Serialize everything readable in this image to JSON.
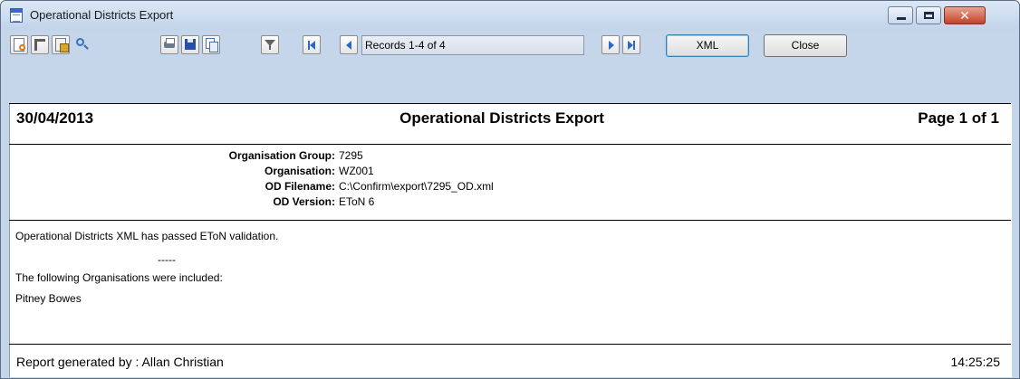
{
  "window": {
    "title": "Operational Districts Export",
    "close_glyph": "✕"
  },
  "toolbar": {
    "records": "Records 1-4 of 4",
    "xml_label": "XML",
    "close_label": "Close",
    "icons": [
      "page-setup-icon",
      "ruler-icon",
      "print-preview-icon",
      "zoom-icon",
      "print-icon",
      "save-icon",
      "copy-icon",
      "filter-icon",
      "first-record-icon",
      "previous-record-icon",
      "next-record-icon",
      "last-record-icon"
    ]
  },
  "report": {
    "date": "30/04/2013",
    "title": "Operational Districts Export",
    "page": "Page 1 of 1",
    "info": [
      {
        "label": "Organisation Group:",
        "value": "7295"
      },
      {
        "label": "Organisation:",
        "value": "WZ001"
      },
      {
        "label": "OD Filename:",
        "value": "C:\\Confirm\\export\\7295_OD.xml"
      },
      {
        "label": "OD Version:",
        "value": "EToN 6"
      }
    ],
    "validation": "Operational Districts XML has passed EToN validation.",
    "separator": "-----",
    "included_heading": "The following Organisations were included:",
    "organisations": [
      "Pitney Bowes"
    ],
    "footer_generated": "Report generated by :  Allan Christian",
    "footer_time": "14:25:25"
  }
}
